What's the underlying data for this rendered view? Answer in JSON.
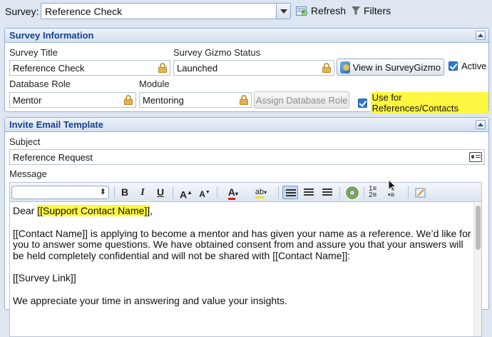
{
  "topbar": {
    "survey_label": "Survey:",
    "survey_value": "Reference Check",
    "refresh_label": "Refresh",
    "filters_label": "Filters"
  },
  "survey_info": {
    "title": "Survey Information",
    "survey_title_label": "Survey Title",
    "survey_title_value": "Reference Check",
    "status_label": "Survey Gizmo Status",
    "status_value": "Launched",
    "view_button": "View in SurveyGizmo",
    "active_label": "Active",
    "active_checked": true,
    "db_role_label": "Database Role",
    "db_role_value": "Mentor",
    "module_label": "Module",
    "module_value": "Mentoring",
    "assign_button": "Assign Database Role",
    "use_for_refs_label": "Use for References/Contacts",
    "use_for_refs_checked": true
  },
  "invite": {
    "title": "Invite Email Template",
    "subject_label": "Subject",
    "subject_value": "Reference Request",
    "message_label": "Message",
    "body": {
      "greeting_prefix": "Dear ",
      "greeting_token": "[[Support Contact Name]]",
      "greeting_suffix": ",",
      "paragraph1": "[[Contact Name]] is applying to become a mentor and has given your name as a reference. We’d like for you to answer some questions. We have obtained consent from and assure you that your answers will be held completely confidential and will not be shared with [[Contact Name]]:",
      "paragraph2": "[[Survey Link]]",
      "paragraph3": "We appreciate your time in answering and value your insights."
    }
  },
  "colors": {
    "accent": "#15428b",
    "highlight": "#fff740",
    "checkbox": "#2f7ad1"
  }
}
